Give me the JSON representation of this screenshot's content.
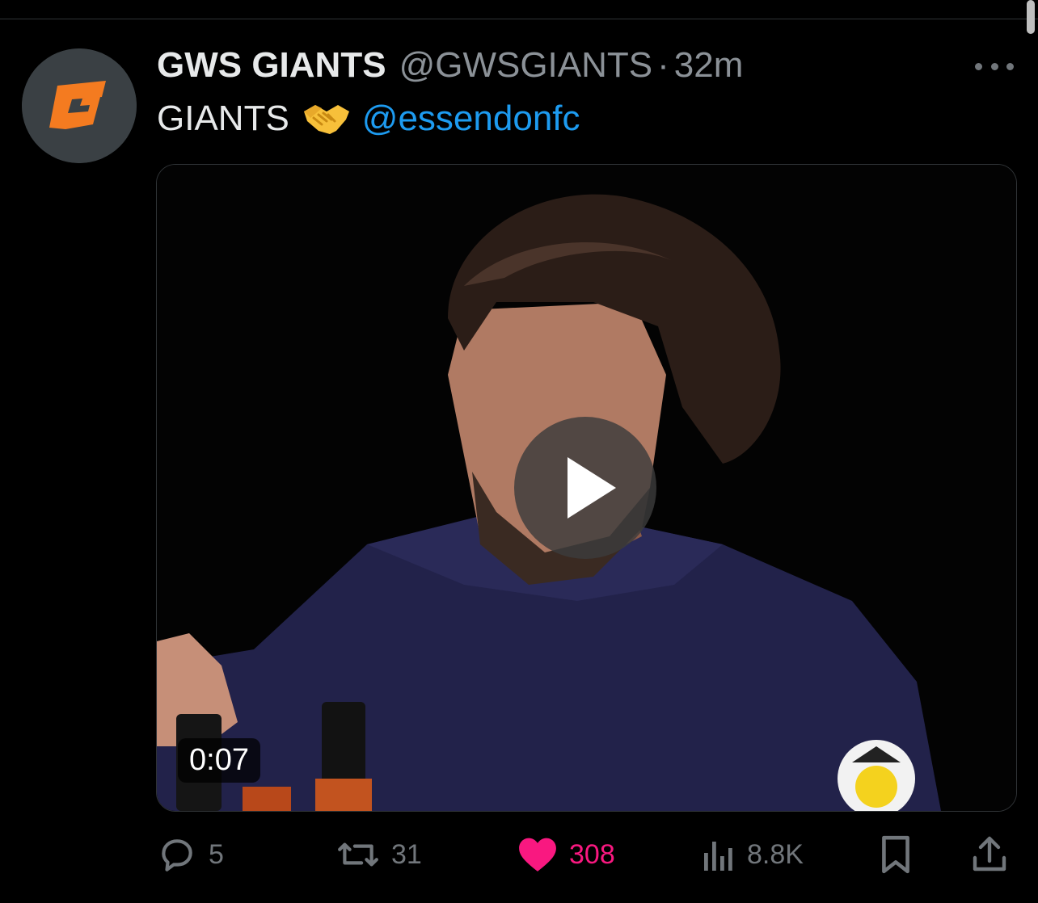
{
  "tweet": {
    "display_name": "GWS GIANTS",
    "handle": "@GWSGIANTS",
    "separator": "·",
    "time": "32m",
    "text": "GIANTS",
    "emoji_icon": "handshake-icon",
    "mention": "@essendonfc",
    "avatar_logo": "G"
  },
  "media": {
    "type": "video",
    "duration": "0:07",
    "play_icon": "play-icon"
  },
  "actions": {
    "reply": {
      "icon": "reply-icon",
      "count": "5"
    },
    "retweet": {
      "icon": "retweet-icon",
      "count": "31"
    },
    "like": {
      "icon": "heart-icon",
      "count": "308",
      "liked": true,
      "color": "#f91880"
    },
    "views": {
      "icon": "views-icon",
      "count": "8.8K"
    },
    "bookmark": {
      "icon": "bookmark-icon"
    },
    "share": {
      "icon": "share-icon"
    }
  },
  "colors": {
    "background": "#000000",
    "text": "#e7e9ea",
    "muted": "#71767b",
    "link": "#1d9bf0",
    "like": "#f91880",
    "logo_orange": "#f47b20"
  }
}
